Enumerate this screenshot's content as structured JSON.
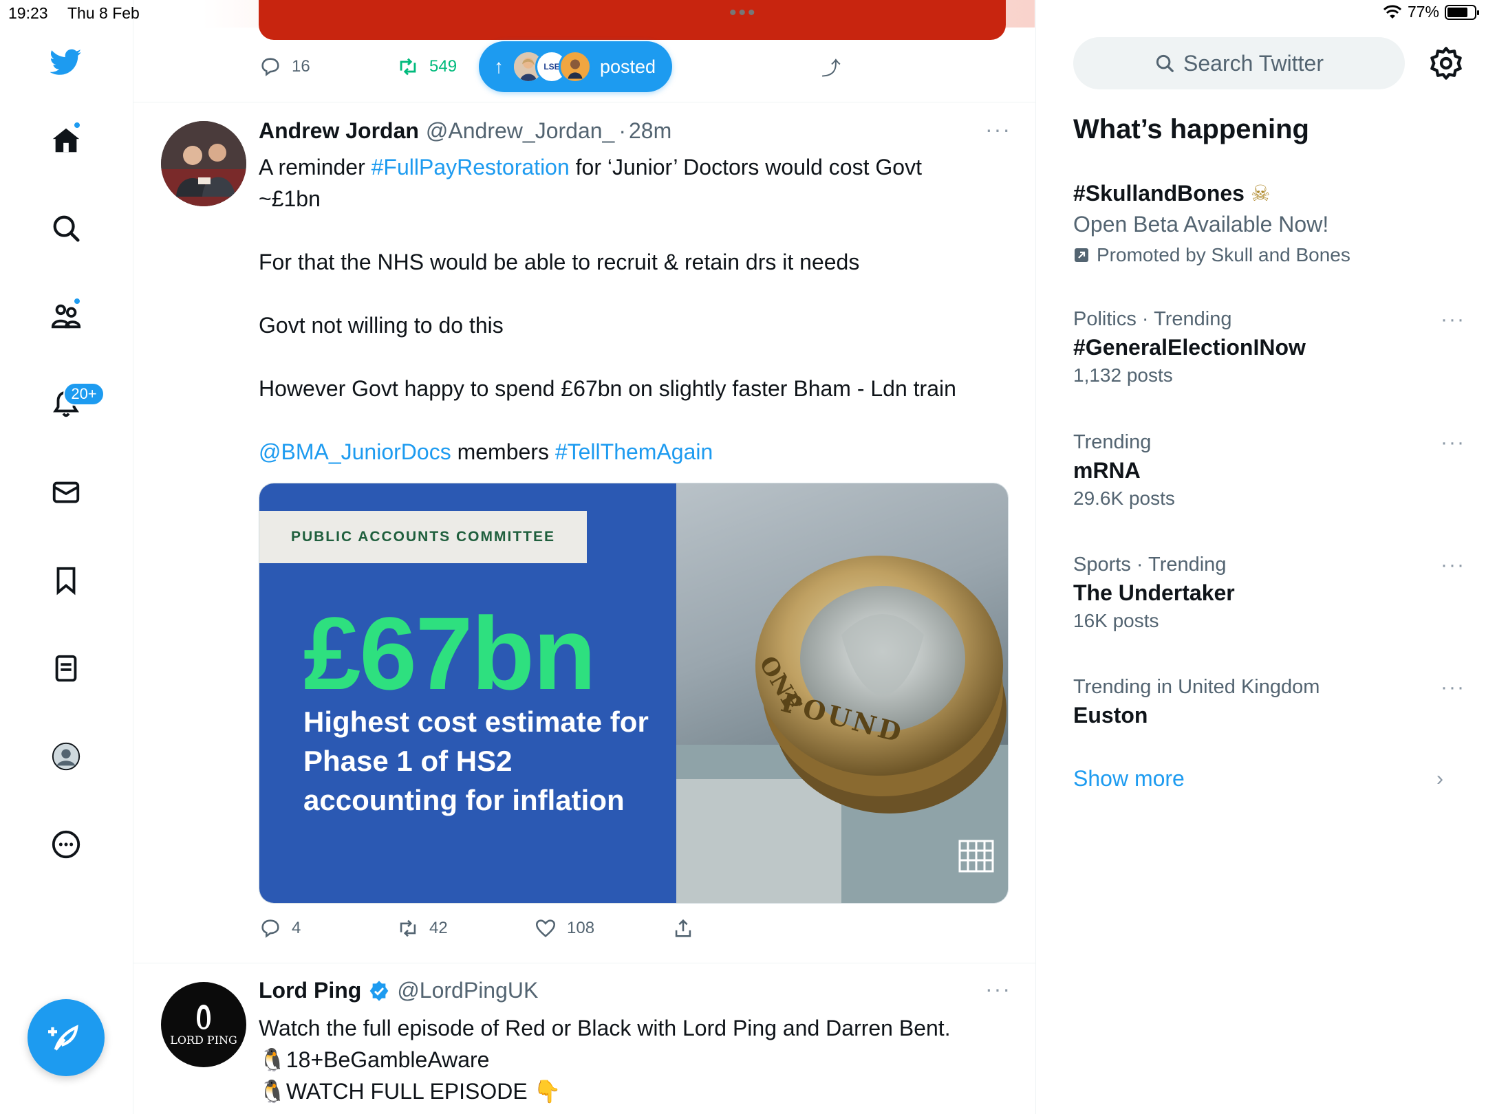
{
  "status_bar": {
    "time": "19:23",
    "date": "Thu 8 Feb",
    "battery": "77%"
  },
  "nav": {
    "items": [
      "twitter-logo",
      "home",
      "explore",
      "communities",
      "notifications",
      "messages",
      "bookmarks",
      "lists",
      "profile",
      "more"
    ],
    "notifications_badge": "20+"
  },
  "top_tweet_actions": {
    "replies": "16",
    "retweets": "549"
  },
  "new_posts_pill": {
    "label": "posted",
    "avatar_text": "LSE"
  },
  "tweets": [
    {
      "name": "Andrew Jordan",
      "handle": "@Andrew_Jordan_",
      "separator": "·",
      "time": "28m",
      "text": {
        "l1_pre": "A reminder ",
        "l1_tag": "#FullPayRestoration",
        "l1_post": " for ‘Junior’ Doctors would cost Govt",
        "l2": "~£1bn",
        "p2": "For that the NHS would be able to recruit & retain drs it needs",
        "p3": "Govt not willing to do this",
        "p4": "However Govt happy to spend £67bn on slightly faster Bham - Ldn train",
        "p5_mention": "@BMA_JuniorDocs",
        "p5_mid": " members ",
        "p5_tag": "#TellThemAgain"
      },
      "media": {
        "header": "PUBLIC ACCOUNTS COMMITTEE",
        "big_number": "£67bn",
        "caption": "Highest cost estimate for Phase 1 of HS2 accounting for inflation",
        "coin_text_1": "ONE",
        "coin_text_2": "POUND"
      },
      "actions": {
        "replies": "4",
        "retweets": "42",
        "likes": "108"
      }
    },
    {
      "name": "Lord Ping",
      "handle": "@LordPingUK",
      "avatar_text": "LORD PING",
      "line1": "Watch the full episode of Red or Black with Lord Ping and Darren Bent.",
      "line2": "18+BeGambleAware",
      "line3": "WATCH FULL EPISODE",
      "emoji_penguin": "🐧",
      "emoji_point": "👇"
    }
  ],
  "sidebar": {
    "search_placeholder": "Search Twitter",
    "section_title": "What’s happening",
    "promoted": {
      "topic": "#SkullandBones",
      "emoji": "☠",
      "description": "Open Beta Available Now!",
      "promoted_by": "Promoted by Skull and Bones"
    },
    "trends": [
      {
        "context": "Politics · Trending",
        "topic": "#GeneralElectionINow",
        "count": "1,132 posts"
      },
      {
        "context": "Trending",
        "topic": "mRNA",
        "count": "29.6K posts"
      },
      {
        "context": "Sports · Trending",
        "topic": "The Undertaker",
        "count": "16K posts"
      },
      {
        "context": "Trending in United Kingdom",
        "topic": "Euston",
        "count": ""
      }
    ],
    "show_more": "Show more",
    "more_dots": "···"
  },
  "colors": {
    "accent": "#1d9bf0",
    "retweet_green": "#00ba7c",
    "text": "#0f1419",
    "muted": "#536471"
  }
}
